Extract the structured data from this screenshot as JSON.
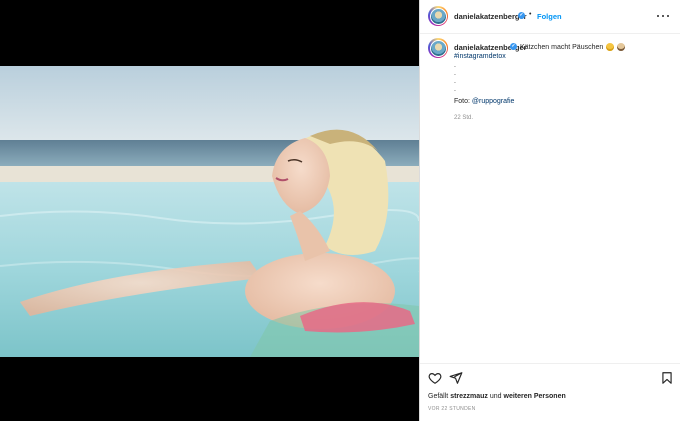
{
  "post": {
    "username": "danielakatzenberger",
    "verified_mark": "✓",
    "separator": "•",
    "follow_label": "Folgen",
    "caption_text": "Kätzchen macht Päuschen",
    "caption_emojis": [
      "grimacing-face-emoji",
      "cat-face-emoji"
    ],
    "hashtag": "#instagramdetox",
    "caption_dots": [
      ".",
      ".",
      ".",
      "."
    ],
    "credit_prefix": "Foto: ",
    "credit_mention": "@ruppografie",
    "comment_time": "22 Std."
  },
  "image": {
    "description_icon": "photo-woman-in-pool"
  },
  "actions": {
    "icons": [
      "heart-icon",
      "share-icon",
      "bookmark-icon"
    ],
    "likes_prefix": "Gefällt ",
    "liked_by": "strezzmauz",
    "likes_middle": " und ",
    "likes_others": "weiteren Personen",
    "posted_time": "VOR 22 STUNDEN"
  },
  "colors": {
    "accent": "#0095f6",
    "link": "#00376b",
    "muted": "#8e8e8e",
    "verified": "#3897f0"
  }
}
